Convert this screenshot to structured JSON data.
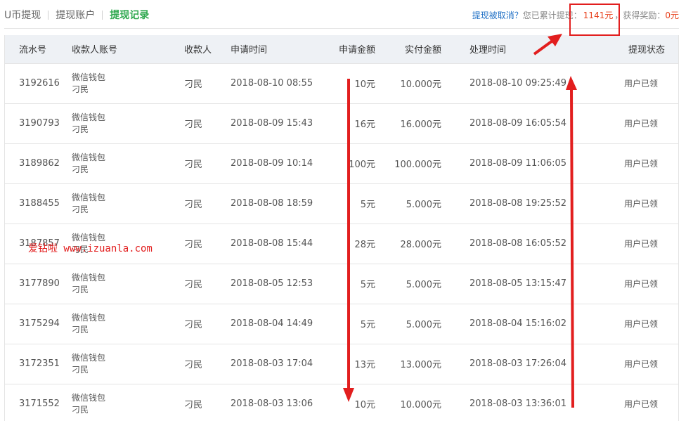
{
  "tabs": [
    {
      "label": "U币提现",
      "active": false
    },
    {
      "label": "提现账户",
      "active": false
    },
    {
      "label": "提现记录",
      "active": true
    }
  ],
  "summary": {
    "cancel_link": "提现被取消？",
    "total_prefix": "您已累计提现：",
    "total_amount": "1141元",
    "reward_prefix": "，获得奖励：",
    "reward_amount": "0元"
  },
  "table": {
    "headers": [
      "流水号",
      "收款人账号",
      "收款人",
      "申请时间",
      "申请金额",
      "实付金额",
      "处理时间",
      "提现状态"
    ],
    "rows": [
      {
        "id": "3192616",
        "account_type": "微信钱包",
        "account_name": "刁民",
        "payee": "刁民",
        "apply_time": "2018-08-10 08:55",
        "amount": "10元",
        "paid": "10.000元",
        "process_time": "2018-08-10 09:25:49",
        "status": "用户已领"
      },
      {
        "id": "3190793",
        "account_type": "微信钱包",
        "account_name": "刁民",
        "payee": "刁民",
        "apply_time": "2018-08-09 15:43",
        "amount": "16元",
        "paid": "16.000元",
        "process_time": "2018-08-09 16:05:54",
        "status": "用户已领"
      },
      {
        "id": "3189862",
        "account_type": "微信钱包",
        "account_name": "刁民",
        "payee": "刁民",
        "apply_time": "2018-08-09 10:14",
        "amount": "100元",
        "paid": "100.000元",
        "process_time": "2018-08-09 11:06:05",
        "status": "用户已领"
      },
      {
        "id": "3188455",
        "account_type": "微信钱包",
        "account_name": "刁民",
        "payee": "刁民",
        "apply_time": "2018-08-08 18:59",
        "amount": "5元",
        "paid": "5.000元",
        "process_time": "2018-08-08 19:25:52",
        "status": "用户已领"
      },
      {
        "id": "3187857",
        "account_type": "微信钱包",
        "account_name": "刁民",
        "payee": "刁民",
        "apply_time": "2018-08-08 15:44",
        "amount": "28元",
        "paid": "28.000元",
        "process_time": "2018-08-08 16:05:52",
        "status": "用户已领"
      },
      {
        "id": "3177890",
        "account_type": "微信钱包",
        "account_name": "刁民",
        "payee": "刁民",
        "apply_time": "2018-08-05 12:53",
        "amount": "5元",
        "paid": "5.000元",
        "process_time": "2018-08-05 13:15:47",
        "status": "用户已领"
      },
      {
        "id": "3175294",
        "account_type": "微信钱包",
        "account_name": "刁民",
        "payee": "刁民",
        "apply_time": "2018-08-04 14:49",
        "amount": "5元",
        "paid": "5.000元",
        "process_time": "2018-08-04 15:16:02",
        "status": "用户已领"
      },
      {
        "id": "3172351",
        "account_type": "微信钱包",
        "account_name": "刁民",
        "payee": "刁民",
        "apply_time": "2018-08-03 17:04",
        "amount": "13元",
        "paid": "13.000元",
        "process_time": "2018-08-03 17:26:04",
        "status": "用户已领"
      },
      {
        "id": "3171552",
        "account_type": "微信钱包",
        "account_name": "刁民",
        "payee": "刁民",
        "apply_time": "2018-08-03 13:06",
        "amount": "10元",
        "paid": "10.000元",
        "process_time": "2018-08-03 13:36:01",
        "status": "用户已领"
      }
    ]
  },
  "watermark": "爱钻啦 www.izuanla.com",
  "colors": {
    "accent_green": "#2fa84f",
    "amount_red": "#e8431f",
    "link_blue": "#1e6fc5",
    "annotation_red": "#e21e1e",
    "header_bg": "#eef1f5"
  }
}
